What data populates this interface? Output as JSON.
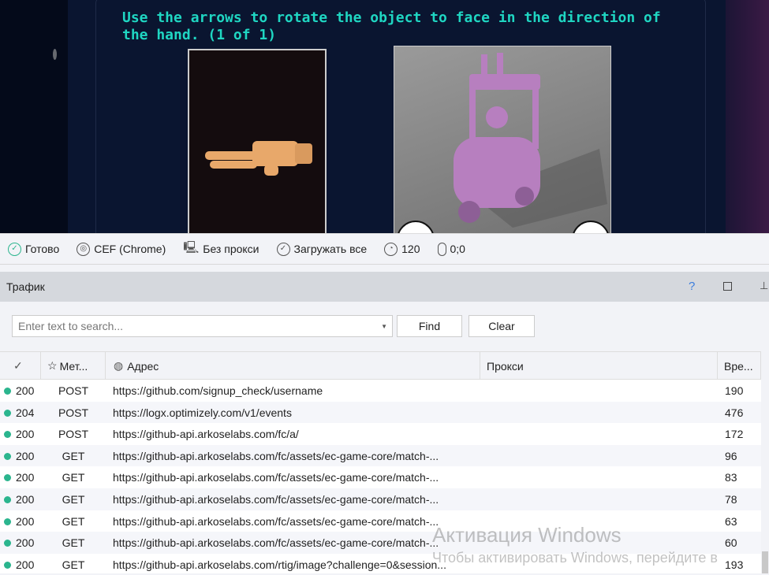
{
  "browser": {
    "prompt": "Use the arrows to rotate the object to face in the direction of the hand. (1 of 1)"
  },
  "status": {
    "ready": "Готово",
    "engine": "CEF (Chrome)",
    "proxy": "Без прокси",
    "load": "Загружать все",
    "timeout": "120",
    "coords": "0;0"
  },
  "panel": {
    "title": "Трафик",
    "help": "?"
  },
  "search": {
    "placeholder": "Enter text to search...",
    "find": "Find",
    "clear": "Clear"
  },
  "table": {
    "headers": {
      "method": "Мет...",
      "address": "Адрес",
      "proxy": "Прокси",
      "time": "Вре..."
    },
    "rows": [
      {
        "status": "200",
        "method": "POST",
        "url": "https://github.com/signup_check/username",
        "time": "190"
      },
      {
        "status": "204",
        "method": "POST",
        "url": "https://logx.optimizely.com/v1/events",
        "time": "476"
      },
      {
        "status": "200",
        "method": "POST",
        "url": "https://github-api.arkoselabs.com/fc/a/",
        "time": "172"
      },
      {
        "status": "200",
        "method": "GET",
        "url": "https://github-api.arkoselabs.com/fc/assets/ec-game-core/match-...",
        "time": "96"
      },
      {
        "status": "200",
        "method": "GET",
        "url": "https://github-api.arkoselabs.com/fc/assets/ec-game-core/match-...",
        "time": "83"
      },
      {
        "status": "200",
        "method": "GET",
        "url": "https://github-api.arkoselabs.com/fc/assets/ec-game-core/match-...",
        "time": "78"
      },
      {
        "status": "200",
        "method": "GET",
        "url": "https://github-api.arkoselabs.com/fc/assets/ec-game-core/match-...",
        "time": "63"
      },
      {
        "status": "200",
        "method": "GET",
        "url": "https://github-api.arkoselabs.com/fc/assets/ec-game-core/match-...",
        "time": "60"
      },
      {
        "status": "200",
        "method": "GET",
        "url": "https://github-api.arkoselabs.com/rtig/image?challenge=0&session...",
        "time": "193"
      }
    ]
  },
  "watermark": {
    "line1": "Активация Windows",
    "line2": "Чтобы активировать Windows, перейдите в"
  },
  "colors": {
    "prompt": "#1fd6c2",
    "ok_dot": "#2bb58e",
    "accent": "#3b7ddd"
  }
}
